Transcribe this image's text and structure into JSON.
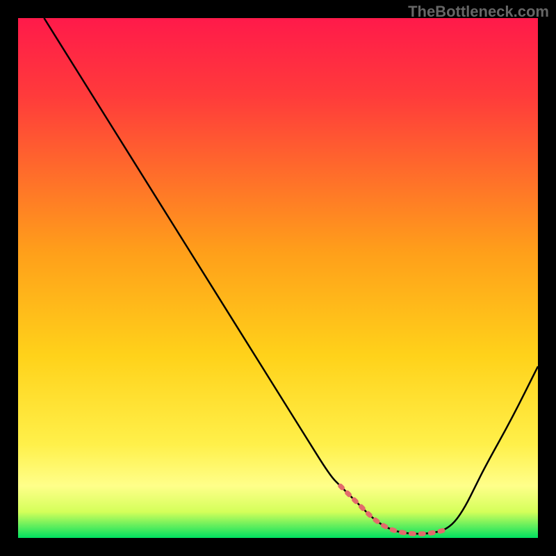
{
  "watermark": "TheBottleneck.com",
  "colors": {
    "bg": "#000000",
    "gradient_top": "#ff1a4a",
    "gradient_mid": "#ffcc00",
    "gradient_bottom_y": "#ffff66",
    "gradient_bottom": "#00e060",
    "curve": "#000000",
    "highlight": "#e26b6b"
  },
  "chart_data": {
    "type": "line",
    "title": "",
    "xlabel": "",
    "ylabel": "",
    "xlim": [
      0,
      100
    ],
    "ylim": [
      0,
      100
    ],
    "series": [
      {
        "name": "curve",
        "x": [
          5,
          10,
          15,
          20,
          25,
          30,
          35,
          40,
          45,
          50,
          55,
          60,
          62,
          64,
          66,
          68,
          70,
          72,
          74,
          76,
          78,
          80,
          82,
          84,
          86,
          88,
          90,
          95,
          100
        ],
        "y": [
          100,
          92,
          84,
          76,
          68,
          60,
          52,
          44,
          36,
          28,
          20,
          12,
          10,
          8,
          6,
          4,
          2.5,
          1.5,
          1,
          0.8,
          0.8,
          1,
          1.5,
          3,
          6,
          10,
          14,
          23,
          33
        ]
      },
      {
        "name": "highlight-dash",
        "x": [
          62,
          82
        ],
        "y": [
          8,
          1.5
        ]
      }
    ]
  }
}
